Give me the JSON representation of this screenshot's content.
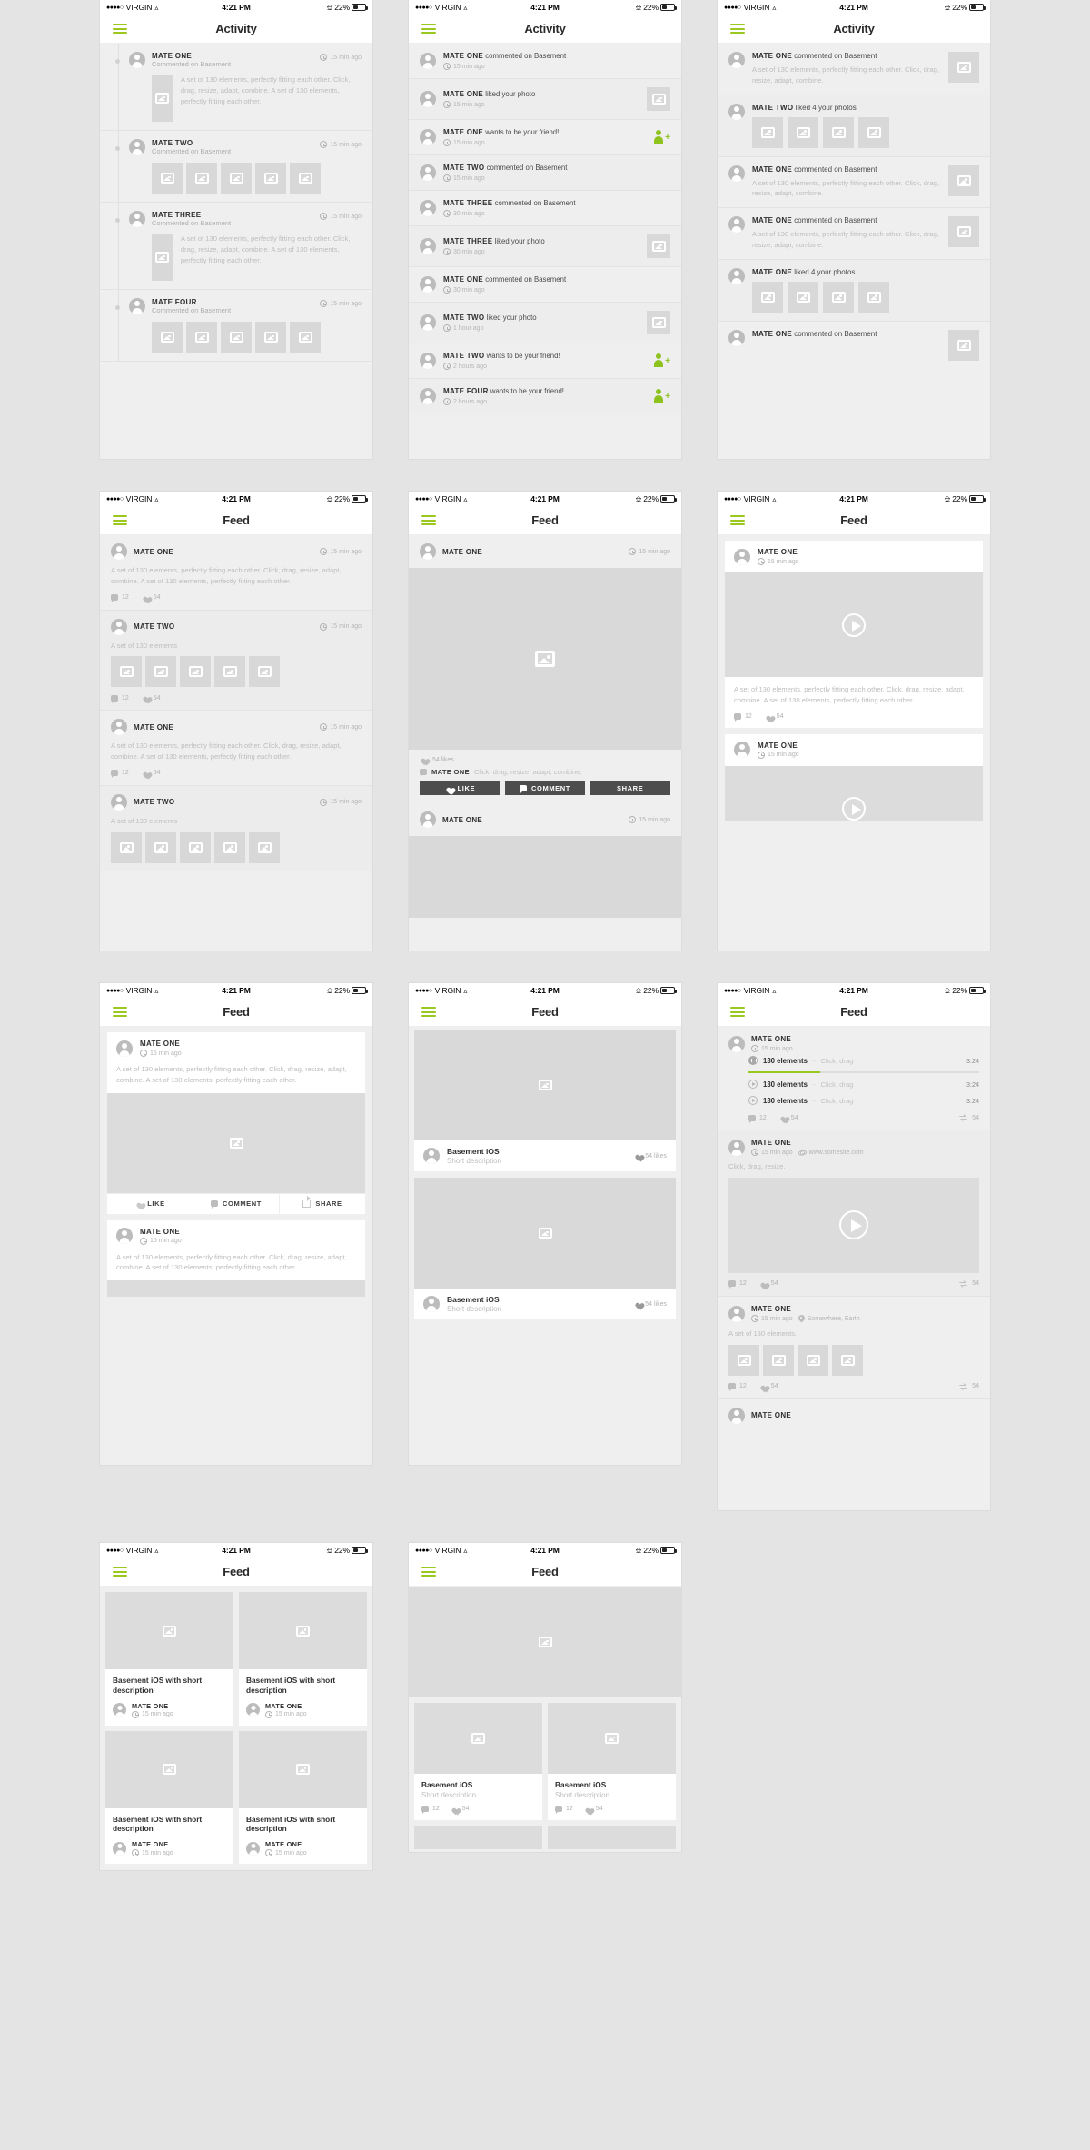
{
  "status_bar": {
    "dots": "●●●●○",
    "carrier": "VIRGIN",
    "wifi_icon": "wifi-icon",
    "time": "4:21 PM",
    "bluetooth_icon": "bluetooth-icon",
    "battery_percent": "22%"
  },
  "screens": {
    "activity_timeline": {
      "title": "Activity",
      "items": [
        {
          "name": "MATE ONE",
          "action": "Commented on Basement",
          "time": "15 min ago",
          "text": "A set of 130 elements, perfectly fitting each other. Click, drag, resize, adapt, combine. A set of 130 elements, perfectly fitting each other.",
          "thumbs": 0,
          "has_thumb": true
        },
        {
          "name": "MATE TWO",
          "action": "Commented on Basement",
          "time": "15 min ago",
          "text": "",
          "thumbs": 5,
          "has_thumb": false
        },
        {
          "name": "MATE THREE",
          "action": "Commented on Basement",
          "time": "15 min ago",
          "text": "A set of 130 elements, perfectly fitting each other. Click, drag, resize, adapt, combine. A set of 130 elements, perfectly fitting each other.",
          "thumbs": 0,
          "has_thumb": true
        },
        {
          "name": "MATE FOUR",
          "action": "Commented on Basement",
          "time": "15 min ago",
          "text": "",
          "thumbs": 5,
          "has_thumb": false
        }
      ]
    },
    "activity_compact": {
      "title": "Activity",
      "items": [
        {
          "name": "MATE ONE",
          "action": "commented on Basement",
          "time": "15 min ago",
          "right": "none"
        },
        {
          "name": "MATE ONE",
          "action": "liked your photo",
          "time": "15 min ago",
          "right": "thumb"
        },
        {
          "name": "MATE ONE",
          "action": "wants to be your friend!",
          "time": "15 min ago",
          "right": "friend"
        },
        {
          "name": "MATE TWO",
          "action": "commented on Basement",
          "time": "15 min ago",
          "right": "none"
        },
        {
          "name": "MATE THREE",
          "action": "commented on Basement",
          "time": "30 min ago",
          "right": "none"
        },
        {
          "name": "MATE THREE",
          "action": "liked your photo",
          "time": "30 min ago",
          "right": "thumb"
        },
        {
          "name": "MATE ONE",
          "action": "commented on Basement",
          "time": "30 min ago",
          "right": "none"
        },
        {
          "name": "MATE TWO",
          "action": "liked your photo",
          "time": "1 hour ago",
          "right": "thumb"
        },
        {
          "name": "MATE TWO",
          "action": "wants to be your friend!",
          "time": "2 hours ago",
          "right": "friend"
        },
        {
          "name": "MATE FOUR",
          "action": "wants to be your friend!",
          "time": "2 hours ago",
          "right": "friend"
        }
      ]
    },
    "activity_rich": {
      "title": "Activity",
      "items": [
        {
          "name": "MATE ONE",
          "action": "commented on Basement",
          "text": "A set of 130 elements, perfectly fitting each other. Click, drag, resize, adapt, combine.",
          "thumbs": 0,
          "right_thumb": true
        },
        {
          "name": "MATE TWO",
          "action": "liked 4 your photos",
          "text": "",
          "thumbs": 4,
          "right_thumb": false
        },
        {
          "name": "MATE ONE",
          "action": "commented on Basement",
          "text": "A set of 130 elements, perfectly fitting each other. Click, drag, resize, adapt, combine.",
          "thumbs": 0,
          "right_thumb": true
        },
        {
          "name": "MATE ONE",
          "action": "commented on Basement",
          "text": "A set of 130 elements, perfectly fitting each other. Click, drag, resize, adapt, combine.",
          "thumbs": 0,
          "right_thumb": true
        },
        {
          "name": "MATE ONE",
          "action": "liked 4 your photos",
          "text": "",
          "thumbs": 4,
          "right_thumb": false
        },
        {
          "name": "MATE ONE",
          "action": "commented on Basement",
          "text": "",
          "thumbs": 0,
          "right_thumb": true
        }
      ]
    },
    "feed_list": {
      "title": "Feed",
      "items": [
        {
          "name": "MATE ONE",
          "time": "15 min ago",
          "text": "A set of 130 elements, perfectly fitting each other. Click, drag, resize, adapt, combine. A set of 130 elements, perfectly fitting each other.",
          "thumbs": 0,
          "comments": "12",
          "likes": "54"
        },
        {
          "name": "MATE TWO",
          "time": "15 min ago",
          "text": "A set of 130 elements",
          "thumbs": 5,
          "comments": "12",
          "likes": "54"
        },
        {
          "name": "MATE ONE",
          "time": "15 min ago",
          "text": "A set of 130 elements, perfectly fitting each other. Click, drag, resize, adapt, combine. A set of 130 elements, perfectly fitting each other.",
          "thumbs": 0,
          "comments": "12",
          "likes": "54"
        },
        {
          "name": "MATE TWO",
          "time": "15 min ago",
          "text": "A set of 130 elements",
          "thumbs": 5,
          "comments": "12",
          "likes": "54"
        }
      ]
    },
    "feed_photo": {
      "title": "Feed",
      "posts": [
        {
          "name": "MATE ONE",
          "time": "15 min ago",
          "likes_label": "54 likes",
          "comment_author": "MATE ONE",
          "comment_text": "Click, drag, resize, adapt, combine."
        }
      ],
      "actions": {
        "like": "LIKE",
        "comment": "COMMENT",
        "share": "SHARE"
      },
      "second_post": {
        "name": "MATE ONE",
        "time": "15 min ago"
      }
    },
    "feed_video_card": {
      "title": "Feed",
      "posts": [
        {
          "name": "MATE ONE",
          "time": "15 min ago",
          "text": "A set of 130 elements, perfectly fitting each other. Click, drag, resize, adapt, combine. A set of 130 elements, perfectly fitting each other.",
          "comments": "12",
          "likes": "54"
        },
        {
          "name": "MATE ONE",
          "time": "15 min ago",
          "text": "",
          "comments": "",
          "likes": ""
        }
      ]
    },
    "feed_card_actions": {
      "title": "Feed",
      "posts": [
        {
          "name": "MATE ONE",
          "time": "15 min ago",
          "text": "A set of 130 elements, perfectly fitting each other. Click, drag, resize, adapt, combine. A set of 130 elements, perfectly fitting each other."
        },
        {
          "name": "MATE ONE",
          "time": "15 min ago",
          "text": "A set of 130 elements, perfectly fitting each other. Click, drag, resize, adapt, combine. A set of 130 elements, perfectly fitting each other."
        }
      ],
      "actions": {
        "like": "LIKE",
        "comment": "COMMENT",
        "share": "SHARE"
      }
    },
    "feed_media_cards": {
      "title": "Feed",
      "cards": [
        {
          "title": "Basement iOS",
          "subtitle": "Short description",
          "likes": "54 likes"
        },
        {
          "title": "Basement iOS",
          "subtitle": "Short description",
          "likes": "54 likes"
        }
      ]
    },
    "feed_playlist": {
      "title": "Feed",
      "posts": [
        {
          "name": "MATE ONE",
          "time": "15 min ago",
          "tracks": [
            {
              "title": "130 elements",
              "sep": "-",
              "desc": "Click, drag",
              "length": "3:24",
              "state": "pause"
            },
            {
              "title": "130 elements",
              "sep": "-",
              "desc": "Click, drag",
              "length": "3:24",
              "state": "play"
            },
            {
              "title": "130 elements",
              "sep": "-",
              "desc": "Click, drag",
              "length": "3:24",
              "state": "play"
            }
          ],
          "comments": "12",
          "likes": "54",
          "shares": "54"
        },
        {
          "name": "MATE ONE",
          "time": "15 min ago",
          "link": "www.somesite.com",
          "text": "Click, drag, resize.",
          "comments": "12",
          "likes": "54",
          "shares": "54"
        },
        {
          "name": "MATE ONE",
          "time": "15 min ago",
          "location": "Somewhere, Earth",
          "text": "A set of 130 elements.",
          "thumbs": 4,
          "comments": "12",
          "likes": "54",
          "shares": "54"
        },
        {
          "name": "MATE ONE"
        }
      ]
    },
    "feed_grid_cards": {
      "title": "Feed",
      "cards": [
        {
          "title": "Basement iOS with short description",
          "user": "MATE ONE",
          "time": "15 min ago"
        },
        {
          "title": "Basement iOS with short description",
          "user": "MATE ONE",
          "time": "15 min ago"
        },
        {
          "title": "Basement iOS with short description",
          "user": "MATE ONE",
          "time": "15 min ago"
        },
        {
          "title": "Basement iOS with short description",
          "user": "MATE ONE",
          "time": "15 min ago"
        }
      ]
    },
    "feed_hero_grid": {
      "title": "Feed",
      "cards": [
        {
          "title": "Basement iOS",
          "subtitle": "Short description",
          "comments": "12",
          "likes": "54"
        },
        {
          "title": "Basement iOS",
          "subtitle": "Short description",
          "comments": "12",
          "likes": "54"
        }
      ]
    }
  },
  "colors": {
    "accent_green": "#9ac81e",
    "friend_green": "#8dc21f",
    "page_bg": "#e4e4e4",
    "screen_bg": "#efefef",
    "placeholder": "#d8d8d8",
    "dark_button": "#4d4d4d"
  }
}
